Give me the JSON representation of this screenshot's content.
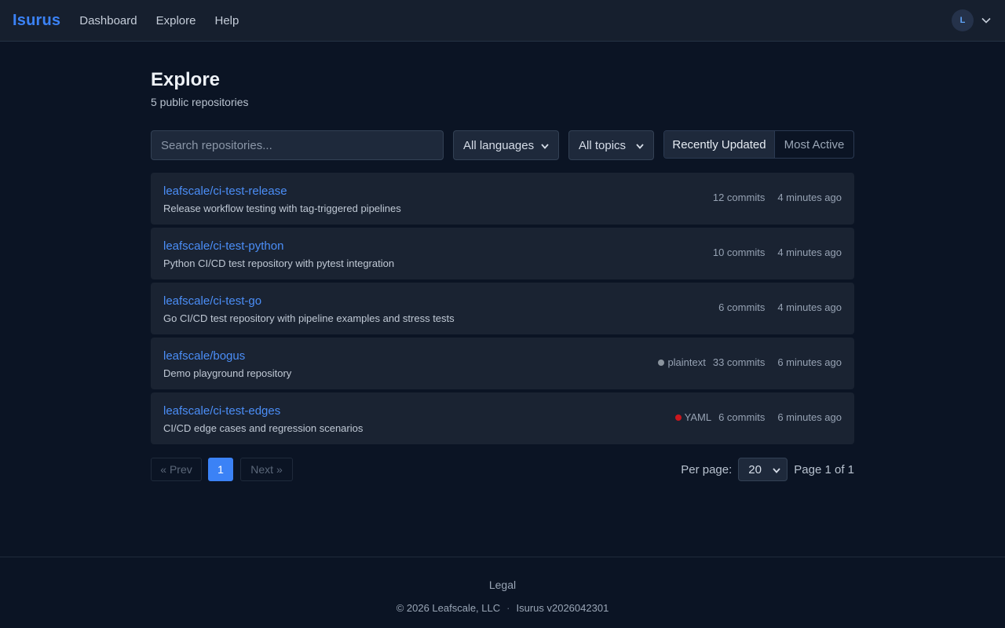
{
  "nav": {
    "brand": "Isurus",
    "links": [
      "Dashboard",
      "Explore",
      "Help"
    ],
    "avatar_initial": "L"
  },
  "page": {
    "title": "Explore",
    "subtitle": "5 public repositories"
  },
  "filters": {
    "search_placeholder": "Search repositories...",
    "language": "All languages",
    "topic": "All topics",
    "sort_active": "Recently Updated",
    "sort_other": "Most Active"
  },
  "repos": [
    {
      "name": "leafscale/ci-test-release",
      "description": "Release workflow testing with tag-triggered pipelines",
      "language": "",
      "language_color": "",
      "commits": "12 commits",
      "updated": "4 minutes ago"
    },
    {
      "name": "leafscale/ci-test-python",
      "description": "Python CI/CD test repository with pytest integration",
      "language": "",
      "language_color": "",
      "commits": "10 commits",
      "updated": "4 minutes ago"
    },
    {
      "name": "leafscale/ci-test-go",
      "description": "Go CI/CD test repository with pipeline examples and stress tests",
      "language": "",
      "language_color": "",
      "commits": "6 commits",
      "updated": "4 minutes ago"
    },
    {
      "name": "leafscale/bogus",
      "description": "Demo playground repository",
      "language": "plaintext",
      "language_color": "#8b949e",
      "commits": "33 commits",
      "updated": "6 minutes ago"
    },
    {
      "name": "leafscale/ci-test-edges",
      "description": "CI/CD edge cases and regression scenarios",
      "language": "YAML",
      "language_color": "#cb171e",
      "commits": "6 commits",
      "updated": "6 minutes ago"
    }
  ],
  "pagination": {
    "prev": "« Prev",
    "current": "1",
    "next": "Next »",
    "per_page_label": "Per page:",
    "per_page_value": "20",
    "page_info": "Page 1 of 1"
  },
  "footer": {
    "legal": "Legal",
    "copyright": "© 2026 Leafscale, LLC",
    "version": "Isurus v2026042301"
  }
}
